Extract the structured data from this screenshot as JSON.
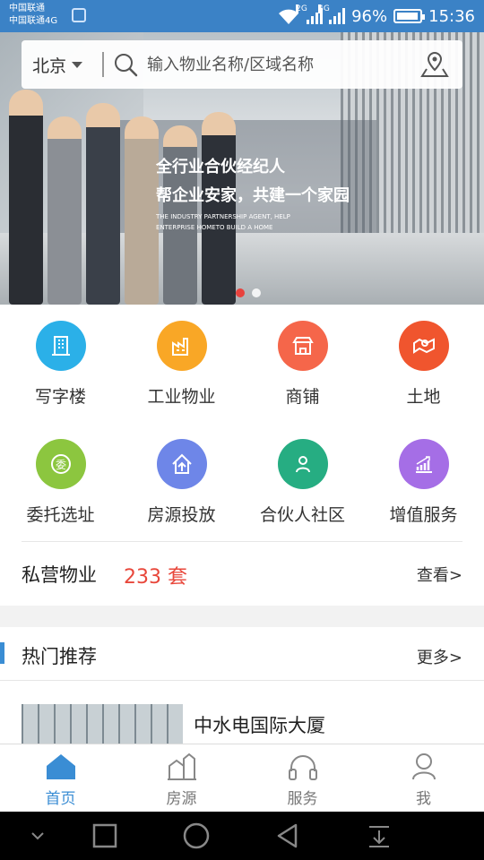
{
  "status_bar": {
    "carrier_1": "中国联通",
    "carrier_2": "中国联通4G",
    "net_1": "2G",
    "net_2": "4G",
    "battery": "96%",
    "battery_level": 0.96,
    "time": "15:36"
  },
  "search": {
    "city": "北京",
    "placeholder": "输入物业名称/区域名称"
  },
  "banner": {
    "title": "全行业合伙经纪人",
    "subtitle": "帮企业安家，共建一个家园",
    "english": "THE INDUSTRY PARTNERSHIP AGENT, HELP ENTERPRISE HOMETO BUILD A HOME",
    "active_slide": 0
  },
  "categories": [
    {
      "label": "写字楼",
      "color": "#2bb0e8",
      "icon": "office-building-icon"
    },
    {
      "label": "工业物业",
      "color": "#f9a726",
      "icon": "factory-icon"
    },
    {
      "label": "商铺",
      "color": "#f5664a",
      "icon": "shop-icon"
    },
    {
      "label": "土地",
      "color": "#f0552e",
      "icon": "land-map-icon"
    },
    {
      "label": "委托选址",
      "color": "#8cc63f",
      "icon": "entrust-icon"
    },
    {
      "label": "房源投放",
      "color": "#6e86e8",
      "icon": "house-upload-icon"
    },
    {
      "label": "合伙人社区",
      "color": "#26ad82",
      "icon": "partner-icon"
    },
    {
      "label": "增值服务",
      "color": "#a56ee6",
      "icon": "chart-icon"
    }
  ],
  "private_property": {
    "label": "私营物业",
    "count": "233 套",
    "view": "查看>"
  },
  "hot": {
    "title": "热门推荐",
    "more": "更多>",
    "items": [
      {
        "name": "中水电国际大厦"
      }
    ]
  },
  "tabs": [
    {
      "label": "首页",
      "icon": "home-icon",
      "active": true
    },
    {
      "label": "房源",
      "icon": "listings-icon",
      "active": false
    },
    {
      "label": "服务",
      "icon": "headset-icon",
      "active": false
    },
    {
      "label": "我",
      "icon": "user-icon",
      "active": false
    }
  ],
  "colors": {
    "status_bar": "#3b82c6",
    "accent": "#3a8dd4",
    "count_red": "#e8473b"
  }
}
